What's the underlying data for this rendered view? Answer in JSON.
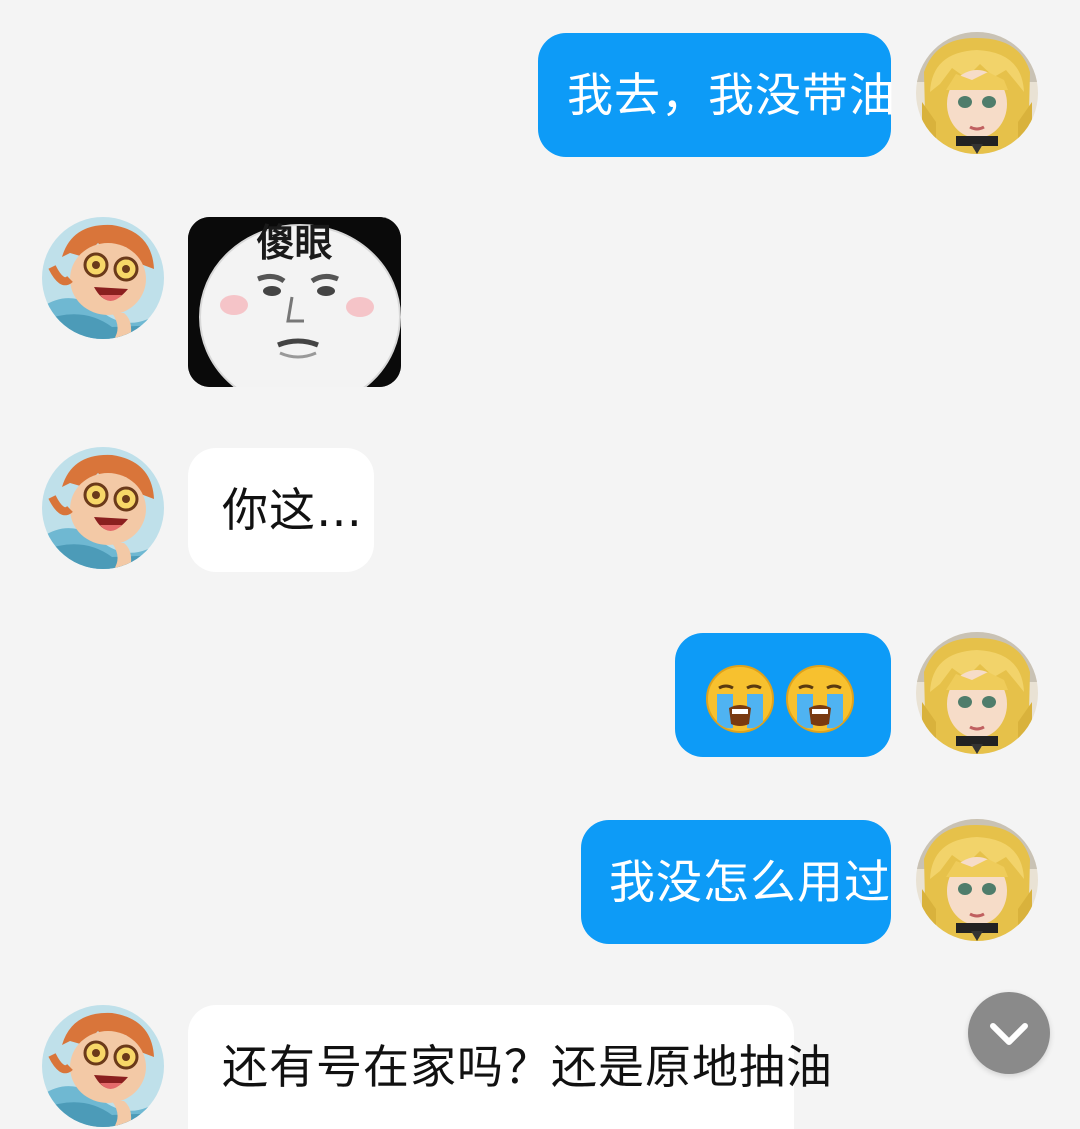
{
  "messages": [
    {
      "direction": "outgoing",
      "type": "text",
      "text": "我去，我没带油"
    },
    {
      "direction": "incoming",
      "type": "sticker",
      "sticker_caption": "傻眼"
    },
    {
      "direction": "incoming",
      "type": "text",
      "text": "你这…"
    },
    {
      "direction": "outgoing",
      "type": "emoji",
      "emojis": [
        "loudly-crying-face-emoji",
        "loudly-crying-face-emoji"
      ]
    },
    {
      "direction": "outgoing",
      "type": "text",
      "text": "我没怎么用过"
    },
    {
      "direction": "incoming",
      "type": "text",
      "text": "还有号在家吗？还是原地抽油"
    }
  ],
  "scroll_button": {
    "icon": "chevron-down-icon"
  },
  "colors": {
    "background": "#f4f4f4",
    "outgoing_bubble": "#0d9bf7",
    "incoming_bubble": "#ffffff",
    "scroll_button": "#8a8a8a"
  }
}
